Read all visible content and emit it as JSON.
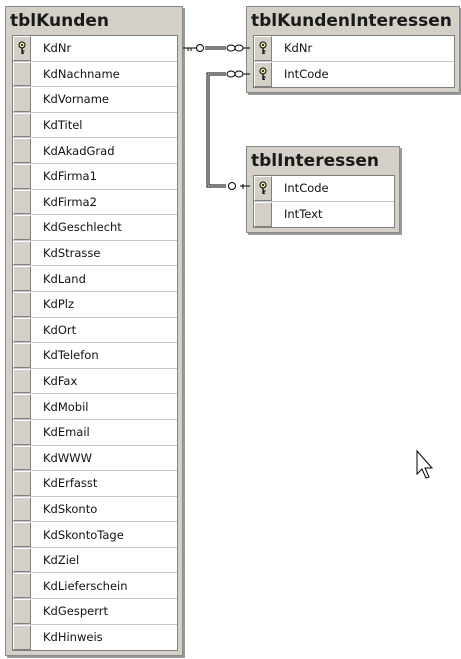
{
  "tables": {
    "kunden": {
      "title": "tblKunden",
      "fields": [
        {
          "name": "KdNr",
          "key": true
        },
        {
          "name": "KdNachname",
          "key": false
        },
        {
          "name": "KdVorname",
          "key": false
        },
        {
          "name": "KdTitel",
          "key": false
        },
        {
          "name": "KdAkadGrad",
          "key": false
        },
        {
          "name": "KdFirma1",
          "key": false
        },
        {
          "name": "KdFirma2",
          "key": false
        },
        {
          "name": "KdGeschlecht",
          "key": false
        },
        {
          "name": "KdStrasse",
          "key": false
        },
        {
          "name": "KdLand",
          "key": false
        },
        {
          "name": "KdPlz",
          "key": false
        },
        {
          "name": "KdOrt",
          "key": false
        },
        {
          "name": "KdTelefon",
          "key": false
        },
        {
          "name": "KdFax",
          "key": false
        },
        {
          "name": "KdMobil",
          "key": false
        },
        {
          "name": "KdEmail",
          "key": false
        },
        {
          "name": "KdWWW",
          "key": false
        },
        {
          "name": "KdErfasst",
          "key": false
        },
        {
          "name": "KdSkonto",
          "key": false
        },
        {
          "name": "KdSkontoTage",
          "key": false
        },
        {
          "name": "KdZiel",
          "key": false
        },
        {
          "name": "KdLieferschein",
          "key": false
        },
        {
          "name": "KdGesperrt",
          "key": false
        },
        {
          "name": "KdHinweis",
          "key": false
        }
      ]
    },
    "kundenInteressen": {
      "title": "tblKundenInteressen",
      "fields": [
        {
          "name": "KdNr",
          "key": true
        },
        {
          "name": "IntCode",
          "key": true
        }
      ]
    },
    "interessen": {
      "title": "tblInteressen",
      "fields": [
        {
          "name": "IntCode",
          "key": true
        },
        {
          "name": "IntText",
          "key": false
        }
      ]
    }
  },
  "relationships": [
    {
      "from_table": "tblKunden",
      "from_field": "KdNr",
      "from_end": "one",
      "to_table": "tblKundenInteressen",
      "to_field": "KdNr",
      "to_end": "many"
    },
    {
      "from_table": "tblInteressen",
      "from_field": "IntCode",
      "from_end": "one",
      "to_table": "tblKundenInteressen",
      "to_field": "IntCode",
      "to_end": "many"
    }
  ],
  "icons": {
    "primary_key": "key-icon",
    "one_end": "key-symbol",
    "many_end": "infinity-symbol",
    "cursor": "mouse-pointer-icon"
  },
  "colors": {
    "table_chrome": "#d4d0c8",
    "line": "#000000"
  }
}
